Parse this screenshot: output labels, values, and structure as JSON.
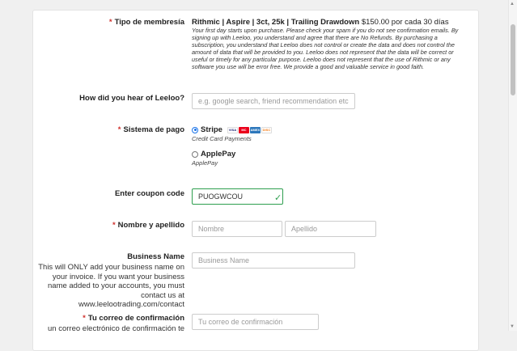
{
  "membership": {
    "label": "Tipo de membresía",
    "plan_bold": "Rithmic | Aspire | 3ct, 25k | Trailing Drawdown",
    "plan_price": " $150.00 por cada 30 días",
    "disclaimer": "Your first day starts upon purchase. Please check your spam if you do not see confirmation emails. By signing up with Leeloo, you understand and agree that there are No Refunds. By purchasing a subscription, you understand that Leeloo does not control or create the data and does not control the amount of data that will be provided to you. Leeloo does not represent that the data will be correct or useful or timely for any particular purpose. Leeloo does not represent that the use of Rithmic or any software you use will be error free. We provide a good and valuable service in good faith."
  },
  "hear": {
    "label": "How did you hear of Leeloo?",
    "placeholder": "e.g. google search, friend recommendation etc"
  },
  "payment": {
    "label": "Sistema de pago",
    "options": [
      {
        "label": "Stripe",
        "sub": "Credit Card Payments"
      },
      {
        "label": "ApplePay",
        "sub": "ApplePay"
      }
    ],
    "card_brands": [
      "VISA",
      "MC",
      "AMEX",
      "DISC"
    ]
  },
  "coupon": {
    "label": "Enter coupon code",
    "value": "PUOGWCOU"
  },
  "name": {
    "label": "Nombre y apellido",
    "first_placeholder": "Nombre",
    "last_placeholder": "Apellido"
  },
  "business": {
    "label": "Business Name",
    "help": "This will ONLY add your business name on your invoice. If you want your business name added to your accounts, you must contact us at www.leelootrading.com/contact",
    "placeholder": "Business Name"
  },
  "email": {
    "label": "Tu correo de confirmación",
    "help": "un correo electrónico de confirmación te",
    "placeholder": "Tu correo de confirmación"
  },
  "required_mark": "*",
  "colors": {
    "accent": "#1a73e8",
    "required": "#d0312d",
    "valid": "#2e9e4f"
  }
}
